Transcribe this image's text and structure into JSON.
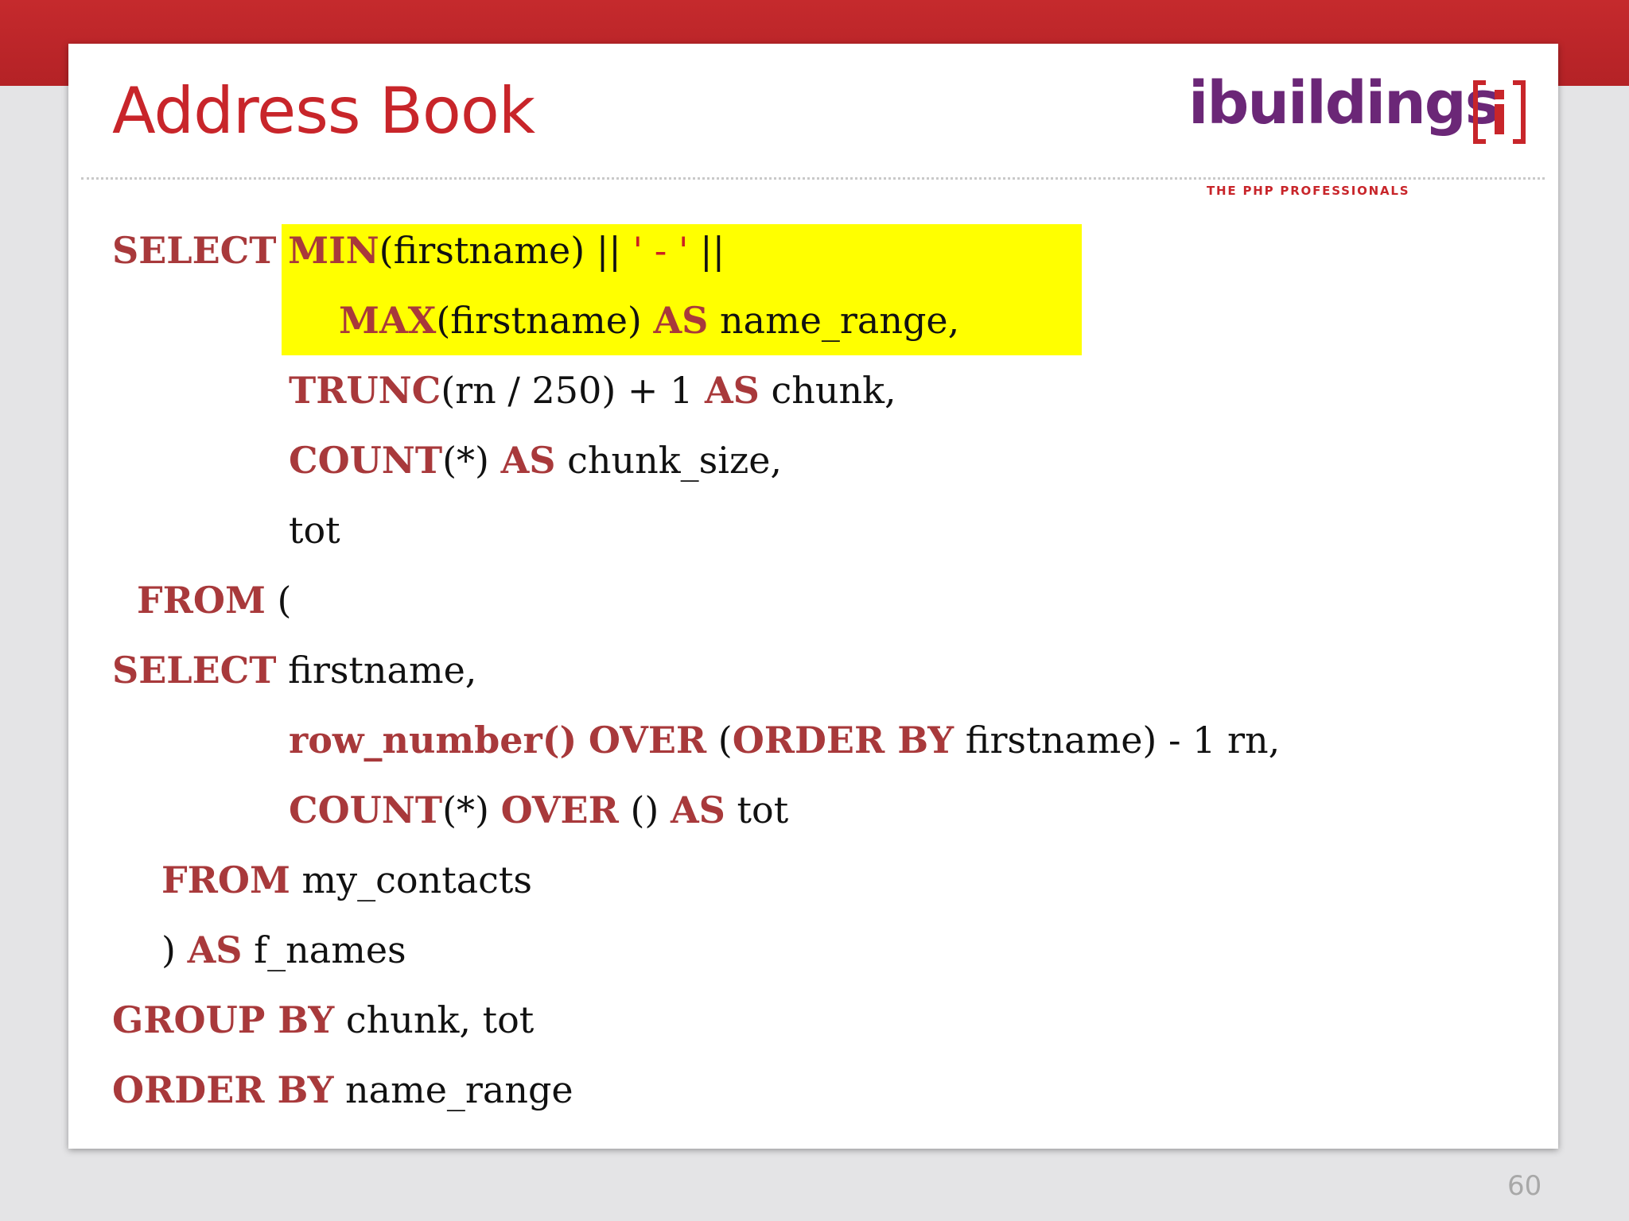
{
  "slide": {
    "title": "Address Book",
    "page_number": "60"
  },
  "logo": {
    "wordmark": "ibuildings",
    "tagline": "THE PHP PROFESSIONALS"
  },
  "code": {
    "highlight_color": "#ffff00",
    "keyword_color": "#a8393b",
    "lines": [
      [
        {
          "t": "SELECT",
          "k": "kw"
        },
        {
          "t": " "
        },
        {
          "t": "MIN",
          "k": "kw"
        },
        {
          "t": "(firstname) || "
        },
        {
          "t": "' - '",
          "k": "str"
        },
        {
          "t": " ||"
        }
      ],
      [
        {
          "t": "MAX",
          "k": "kw"
        },
        {
          "t": "(firstname) "
        },
        {
          "t": "AS",
          "k": "kw"
        },
        {
          "t": " name_range,"
        }
      ],
      [
        {
          "t": "TRUNC",
          "k": "kw"
        },
        {
          "t": "(rn / 250) + 1 "
        },
        {
          "t": "AS",
          "k": "kw"
        },
        {
          "t": " chunk,"
        }
      ],
      [
        {
          "t": "COUNT",
          "k": "kw"
        },
        {
          "t": "(*) "
        },
        {
          "t": "AS",
          "k": "kw"
        },
        {
          "t": " chunk_size,"
        }
      ],
      [
        {
          "t": "tot"
        }
      ],
      [
        {
          "t": "FROM",
          "k": "kw"
        },
        {
          "t": " ("
        }
      ],
      [
        {
          "t": "SELECT",
          "k": "kw"
        },
        {
          "t": " firstname,"
        }
      ],
      [
        {
          "t": "row_number()",
          "k": "kw"
        },
        {
          "t": " "
        },
        {
          "t": "OVER",
          "k": "kw"
        },
        {
          "t": " ("
        },
        {
          "t": "ORDER BY",
          "k": "kw"
        },
        {
          "t": " firstname) - 1 rn,"
        }
      ],
      [
        {
          "t": "COUNT",
          "k": "kw"
        },
        {
          "t": "(*) "
        },
        {
          "t": "OVER",
          "k": "kw"
        },
        {
          "t": " () "
        },
        {
          "t": "AS",
          "k": "kw"
        },
        {
          "t": " tot"
        }
      ],
      [
        {
          "t": "FROM",
          "k": "kw"
        },
        {
          "t": " my_contacts"
        }
      ],
      [
        {
          "t": ") "
        },
        {
          "t": "AS",
          "k": "kw"
        },
        {
          "t": " f_names"
        }
      ],
      [
        {
          "t": "GROUP BY",
          "k": "kw"
        },
        {
          "t": " chunk, tot"
        }
      ],
      [
        {
          "t": "ORDER BY",
          "k": "kw"
        },
        {
          "t": " name_range"
        }
      ]
    ]
  }
}
